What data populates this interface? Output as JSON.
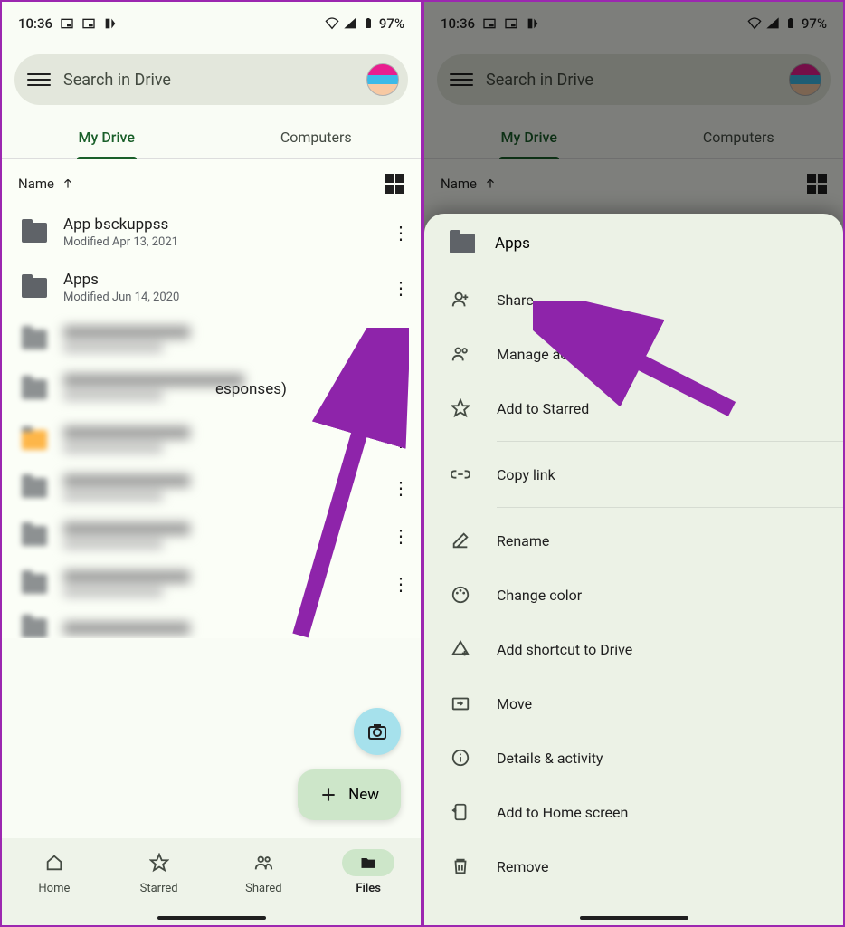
{
  "status": {
    "time": "10:36",
    "battery": "97%"
  },
  "search": {
    "placeholder": "Search in Drive"
  },
  "tabs": {
    "my_drive": "My Drive",
    "computers": "Computers"
  },
  "sort": {
    "label": "Name"
  },
  "files": [
    {
      "name": "App bsckuppss",
      "meta": "Modified Apr 13, 2021"
    },
    {
      "name": "Apps",
      "meta": "Modified Jun 14, 2020"
    }
  ],
  "blurred_suffix": "esponses)",
  "fab": {
    "new_label": "New"
  },
  "nav": {
    "home": "Home",
    "starred": "Starred",
    "shared": "Shared",
    "files": "Files"
  },
  "sheet": {
    "title": "Apps",
    "share": "Share",
    "manage": "Manage access",
    "starred": "Add to Starred",
    "copy": "Copy link",
    "rename": "Rename",
    "color": "Change color",
    "shortcut": "Add shortcut to Drive",
    "move": "Move",
    "details": "Details & activity",
    "homescreen": "Add to Home screen",
    "remove": "Remove"
  }
}
